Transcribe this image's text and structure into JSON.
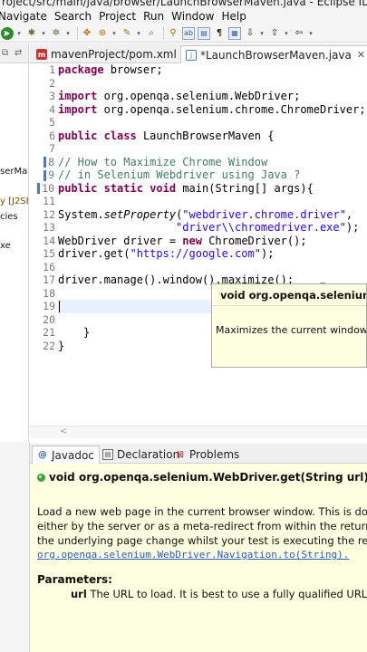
{
  "window": {
    "title": "roject/src/main/java/browser/LaunchBrowserMaven.java - Eclipse IDE"
  },
  "menu": [
    "Navigate",
    "Search",
    "Project",
    "Run",
    "Window",
    "Help"
  ],
  "left_panel": {
    "items": [
      "serMa",
      "y [J2SE",
      "cies",
      "xe"
    ]
  },
  "editor": {
    "tabs": [
      {
        "label": "mavenProject/pom.xml",
        "icon": "maven-icon",
        "active": false
      },
      {
        "label": "*LaunchBrowserMaven.java",
        "icon": "java-file-icon",
        "active": true
      }
    ],
    "line_numbers": [
      "1",
      "2",
      "3",
      "4",
      "5",
      "6",
      "7",
      "8",
      "9",
      "10",
      "11",
      "12",
      "13",
      "14",
      "15",
      "16",
      "17",
      "18",
      "19",
      "20",
      "21",
      "22"
    ],
    "code": {
      "l1": {
        "kw": "package",
        "rest": " browser;"
      },
      "l3": {
        "kw": "import",
        "rest": " org.openqa.selenium.WebDriver;"
      },
      "l4": {
        "kw": "import",
        "rest": " org.openqa.selenium.chrome.ChromeDriver;"
      },
      "l6": {
        "kw1": "public",
        "kw2": "class",
        "rest": " LaunchBrowserMaven {"
      },
      "l8": "// How to Maximize Chrome Window",
      "l9": "// in Selenium Webdriver using Java ?",
      "l10": {
        "kw1": "public",
        "kw2": "static",
        "kw3": "void",
        "rest": " main(String[] args){"
      },
      "l12": {
        "pre": "System.",
        "method": "setProperty",
        "open": "(",
        "str": "\"webdriver.chrome.driver\"",
        "post": ","
      },
      "l13": {
        "str": "\"driver\\\\chromedriver.exe\"",
        "post": ");"
      },
      "l14": {
        "pre": "WebDriver driver = ",
        "kw": "new",
        "rest": " ChromeDriver();"
      },
      "l15": {
        "pre": "driver.get(",
        "str": "\"https://google.com\"",
        "post": ");"
      },
      "l17": "driver.manage().window().maximize();",
      "l20": "}",
      "l21": "}"
    }
  },
  "tooltip": {
    "signature": "void org.openqa.selenium.W",
    "text": "Maximizes the current window if it"
  },
  "bottom_panel": {
    "tabs": [
      {
        "label": "Javadoc",
        "icon": "at-icon",
        "active": true
      },
      {
        "label": "Declaration",
        "icon": "declaration-icon",
        "active": false
      },
      {
        "label": "Problems",
        "icon": "problems-icon",
        "active": false
      }
    ],
    "signature": "void org.openqa.selenium.WebDriver.get(String url)",
    "lines": [
      "Load a new web page in the current browser window. This is done using a",
      "either by the server or as a meta-redirect from within the returned HTML.",
      "the underlying page change whilst your test is executing the results of fut"
    ],
    "link": "org.openqa.selenium.WebDriver.Navigation.to(String).",
    "params_heading": "Parameters:",
    "param_name": "url",
    "param_desc": " The URL to load. It is best to use a fully qualified URL"
  },
  "colors": {
    "keyword": "#7f0055",
    "comment": "#3f7f5f",
    "string": "#2a00ff",
    "javadoc_bg": "#ffffe1",
    "link": "#2a59c1"
  }
}
